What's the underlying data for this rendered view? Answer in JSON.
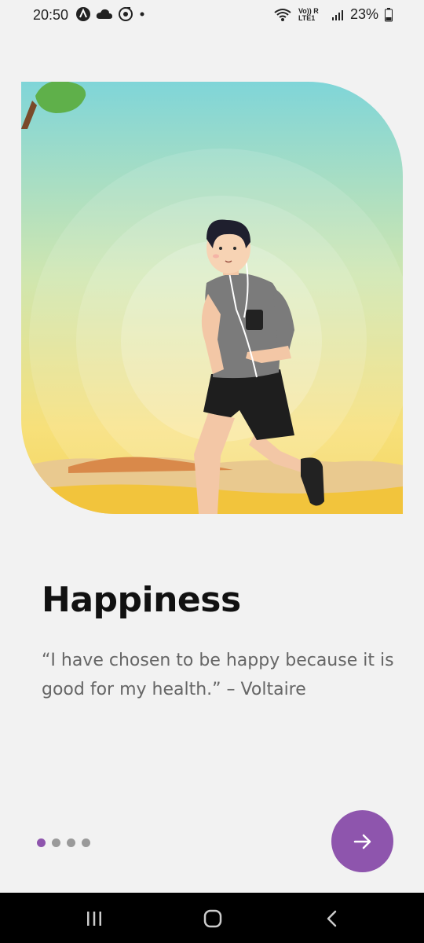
{
  "status_bar": {
    "time": "20:50",
    "battery": "23%",
    "network_label": "Vo)) R LTE1"
  },
  "onboarding": {
    "title": "Happiness",
    "quote": "“I have chosen to be happy because it is good for my health.” – Voltaire",
    "page_count": 4,
    "active_page": 1,
    "next_icon": "arrow-right-icon"
  },
  "colors": {
    "accent": "#8e55ad",
    "background": "#f2f2f2",
    "title": "#111111",
    "quote": "#666666"
  },
  "nav_bar": {
    "icons": [
      "recent-apps-icon",
      "home-icon",
      "back-icon"
    ]
  }
}
